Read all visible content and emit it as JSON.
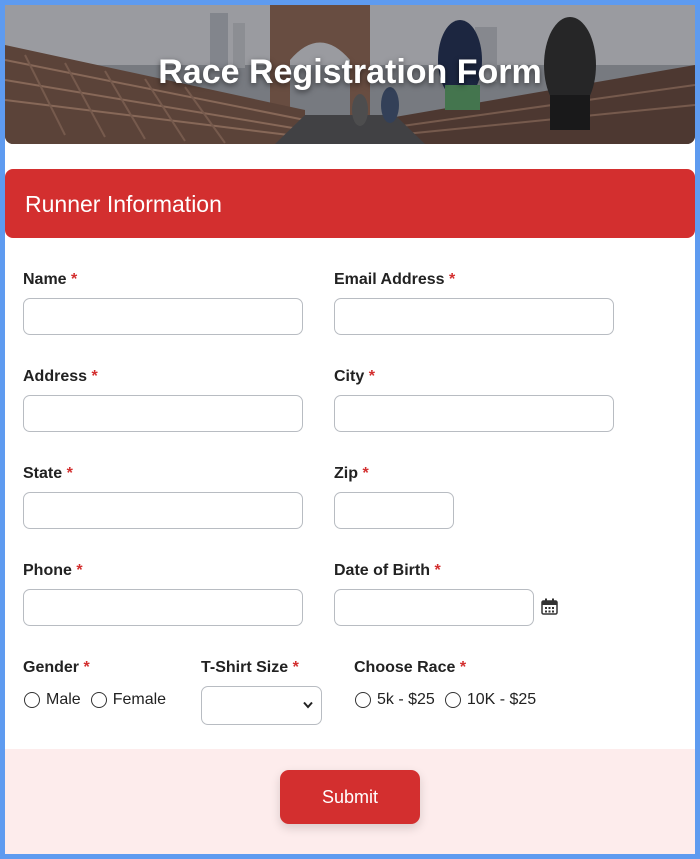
{
  "banner": {
    "title": "Race Registration Form"
  },
  "section": {
    "title": "Runner Information"
  },
  "fields": {
    "name": {
      "label": "Name",
      "required": "*",
      "value": ""
    },
    "email": {
      "label": "Email Address",
      "required": "*",
      "value": ""
    },
    "address": {
      "label": "Address",
      "required": "*",
      "value": ""
    },
    "city": {
      "label": "City",
      "required": "*",
      "value": ""
    },
    "state": {
      "label": "State",
      "required": "*",
      "value": ""
    },
    "zip": {
      "label": "Zip",
      "required": "*",
      "value": ""
    },
    "phone": {
      "label": "Phone",
      "required": "*",
      "value": ""
    },
    "dob": {
      "label": "Date of Birth",
      "required": "*",
      "value": ""
    },
    "gender": {
      "label": "Gender",
      "required": "*",
      "options": [
        "Male",
        "Female"
      ]
    },
    "tshirt": {
      "label": "T-Shirt Size",
      "required": "*",
      "selected": ""
    },
    "race": {
      "label": "Choose Race",
      "required": "*",
      "options": [
        "5k - $25",
        "10K - $25"
      ]
    }
  },
  "submit": {
    "label": "Submit"
  },
  "colors": {
    "accent": "#d32f2f",
    "border": "#5e9bf0",
    "footer_bg": "#fdecec"
  },
  "icons": {
    "calendar": "calendar-icon",
    "chevron": "chevron-down-icon"
  }
}
